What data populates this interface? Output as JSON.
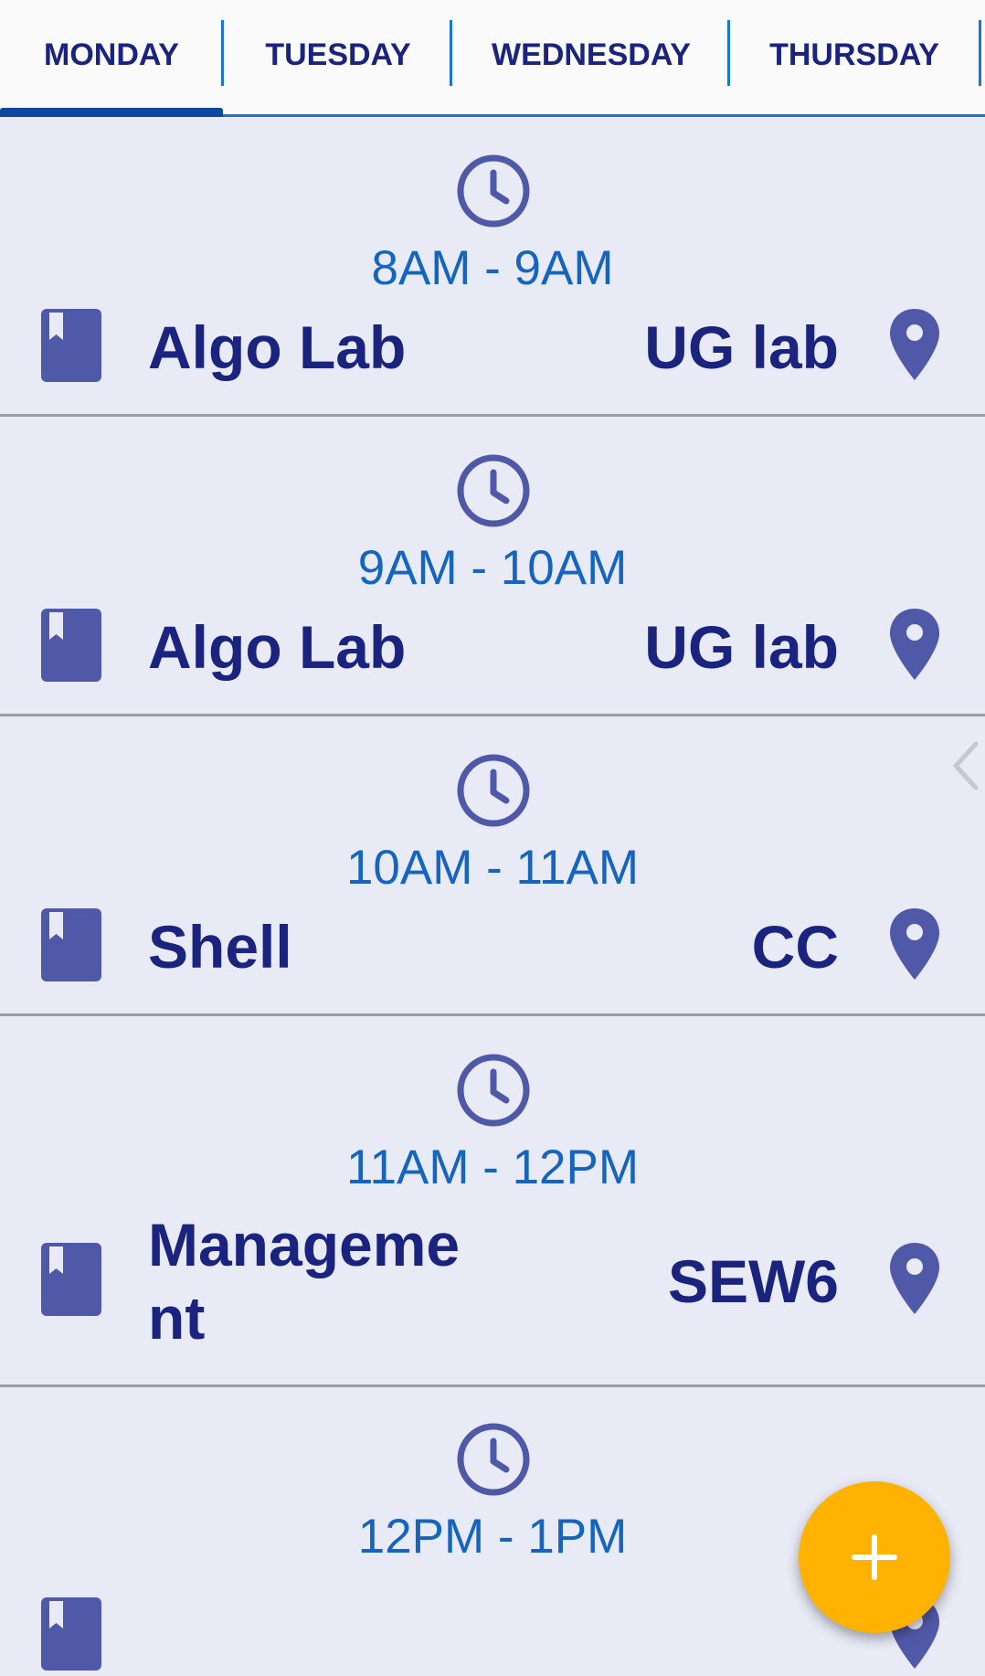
{
  "tabs": [
    {
      "label": "MONDAY",
      "selected": true
    },
    {
      "label": "TUESDAY",
      "selected": false
    },
    {
      "label": "WEDNESDAY",
      "selected": false
    },
    {
      "label": "THURSDAY",
      "selected": false
    }
  ],
  "schedule": [
    {
      "time": "8AM - 9AM",
      "subject": "Algo Lab",
      "room": "UG lab"
    },
    {
      "time": "9AM - 10AM",
      "subject": "Algo Lab",
      "room": "UG lab"
    },
    {
      "time": "10AM - 11AM",
      "subject": "Shell",
      "room": "CC"
    },
    {
      "time": "11AM - 12PM",
      "subject": "Manageme\nnt",
      "room": "SEW6"
    },
    {
      "time": "12PM - 1PM",
      "subject": "",
      "room": ""
    }
  ],
  "icons": {
    "clock": "clock-icon",
    "book": "bookmark-book-icon",
    "location": "location-pin-icon",
    "add": "plus-icon",
    "side_handle": "chevron-left-icon"
  },
  "colors": {
    "background": "#e8eaf6",
    "tab_text": "#1a237e",
    "accent_blue": "#1976d2",
    "time_text": "#1565c0",
    "icon": "#5059a8",
    "fab": "#ffb300"
  }
}
